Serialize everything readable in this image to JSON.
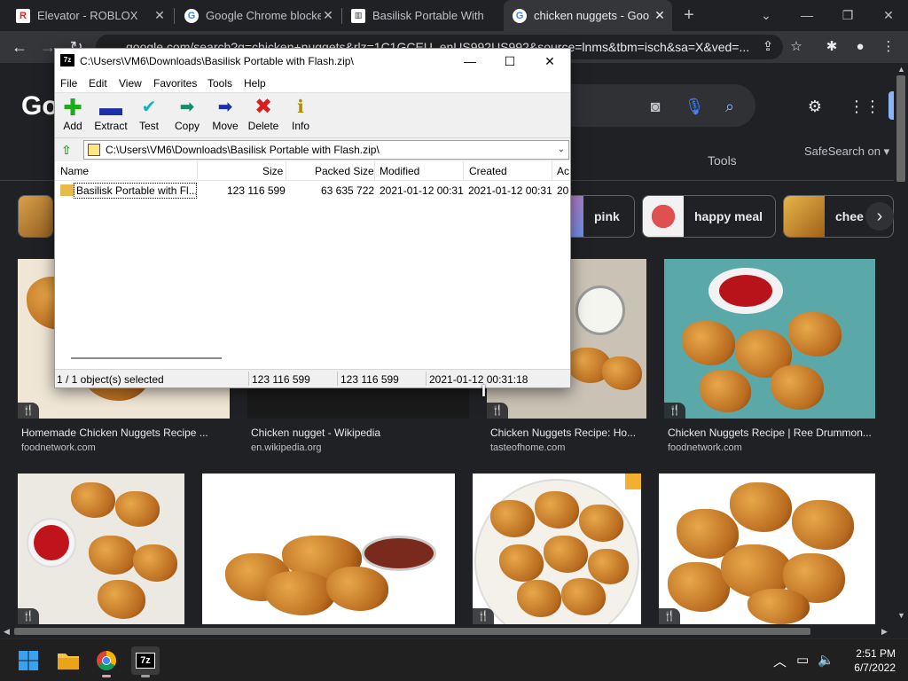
{
  "browser": {
    "tabs": [
      {
        "title": "Elevator - ROBLOX",
        "icon": "roblox-icon"
      },
      {
        "title": "Google Chrome blocked",
        "icon": "google-icon"
      },
      {
        "title": "Basilisk Portable With F",
        "icon": "basilisk-icon"
      },
      {
        "title": "chicken nuggets - Goo",
        "icon": "google-icon",
        "active": true
      }
    ],
    "url": "google.com/search?q=chicken+nuggets&rlz=1C1GCEU_enUS992US992&source=lnms&tbm=isch&sa=X&ved=..."
  },
  "google": {
    "logo": "Go",
    "tools": "Tools",
    "safesearch": "SafeSearch on",
    "chips": [
      "pink",
      "happy meal",
      "chee"
    ],
    "results_row1": [
      {
        "caption": "Homemade Chicken Nuggets Recipe ...",
        "source": "foodnetwork.com"
      },
      {
        "caption": "Chicken nugget - Wikipedia",
        "source": "en.wikipedia.org"
      },
      {
        "caption": "Chicken Nuggets Recipe: Ho...",
        "source": "tasteofhome.com"
      },
      {
        "caption": "Chicken Nuggets Recipe | Ree Drummon...",
        "source": "foodnetwork.com"
      }
    ]
  },
  "sevenzip": {
    "title": "C:\\Users\\VM6\\Downloads\\Basilisk Portable with Flash.zip\\",
    "menu": [
      "File",
      "Edit",
      "View",
      "Favorites",
      "Tools",
      "Help"
    ],
    "toolbar": [
      "Add",
      "Extract",
      "Test",
      "Copy",
      "Move",
      "Delete",
      "Info"
    ],
    "address": "C:\\Users\\VM6\\Downloads\\Basilisk Portable with Flash.zip\\",
    "columns": [
      "Name",
      "Size",
      "Packed Size",
      "Modified",
      "Created",
      "Ac"
    ],
    "rows": [
      {
        "name": "Basilisk Portable with Fl...",
        "size": "123 116 599",
        "packed": "63 635 722",
        "modified": "2021-01-12 00:31",
        "created": "2021-01-12 00:31",
        "accessed": "20"
      }
    ],
    "status": {
      "selection": "1 / 1 object(s) selected",
      "size": "123 116 599",
      "packed": "123 116 599",
      "date": "2021-01-12 00:31:18"
    }
  },
  "taskbar": {
    "time": "2:51 PM",
    "date": "6/7/2022"
  }
}
